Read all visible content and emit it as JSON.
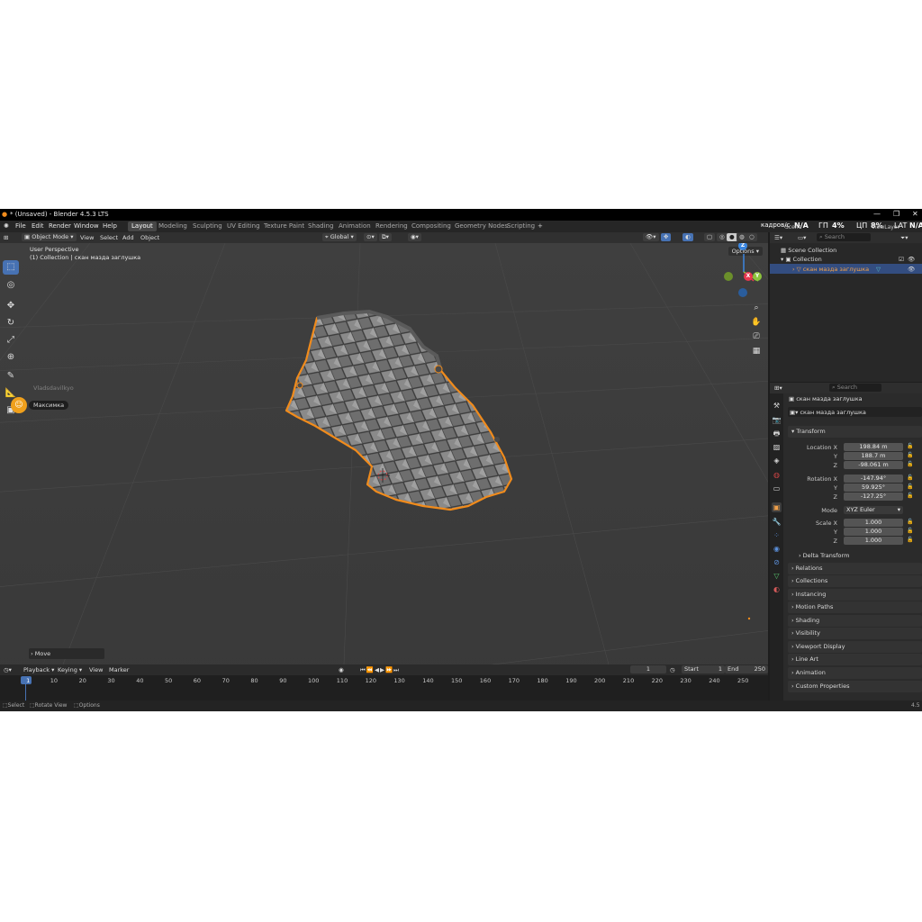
{
  "window": {
    "title": "* (Unsaved) - Blender 4.5.3 LTS",
    "controls": [
      "—",
      "❐",
      "✕"
    ]
  },
  "menus": [
    "File",
    "Edit",
    "Render",
    "Window",
    "Help"
  ],
  "workspaces": [
    "Layout",
    "Modeling",
    "Sculpting",
    "UV Editing",
    "Texture Paint",
    "Shading",
    "Animation",
    "Rendering",
    "Compositing",
    "Geometry Nodes",
    "Scripting"
  ],
  "active_workspace": "Layout",
  "overlay": {
    "fps_label": "кадров/с",
    "fps_value": "N/A",
    "gpu_label": "ГП",
    "gpu_value": "4%",
    "cpu_label": "ЦП",
    "cpu_value": "8%",
    "lat_label": "LAT",
    "lat_value": "N/A",
    "scene": "Scene",
    "view_layer": "ViewLayer"
  },
  "viewport_header": {
    "mode": "Object Mode",
    "menus": [
      "View",
      "Select",
      "Add",
      "Object"
    ],
    "transform_orientation": "Global",
    "options": "Options"
  },
  "viewport": {
    "perspective": "User Perspective",
    "collection_info": "(1) Collection | скан мазда заглушка",
    "move_panel": "Move",
    "gizmo": {
      "x": "X",
      "y": "Y",
      "z": "Z"
    }
  },
  "discord": {
    "user1": "Vladsdavilkyo",
    "user2": "Максимка"
  },
  "timeline": {
    "menus": [
      "Playback",
      "Keying",
      "View",
      "Marker"
    ],
    "current_frame": "1",
    "start_label": "Start",
    "start": "1",
    "end_label": "End",
    "end": "250",
    "ticks": [
      "1",
      "10",
      "20",
      "30",
      "40",
      "50",
      "60",
      "70",
      "80",
      "90",
      "100",
      "110",
      "120",
      "130",
      "140",
      "150",
      "160",
      "170",
      "180",
      "190",
      "200",
      "210",
      "220",
      "230",
      "240",
      "250"
    ]
  },
  "statusbar": {
    "select": "Select",
    "rotate": "Rotate View",
    "options": "Options",
    "version": "4.5"
  },
  "outliner": {
    "search_placeholder": "Search",
    "scene_collection": "Scene Collection",
    "collection": "Collection",
    "object": "скан мазда заглушка"
  },
  "properties": {
    "search_placeholder": "Search",
    "object_name": "скан мазда заглушка",
    "datablock_name": "скан мазда заглушка",
    "transform_title": "Transform",
    "location_label": "Location X",
    "location": [
      "198.84 m",
      "188.7 m",
      "-98.061 m"
    ],
    "rotation_label": "Rotation X",
    "rotation": [
      "-147.94°",
      "59.925°",
      "-127.25°"
    ],
    "mode_label": "Mode",
    "mode_value": "XYZ Euler",
    "scale_label": "Scale X",
    "scale": [
      "1.000",
      "1.000",
      "1.000"
    ],
    "axis_y": "Y",
    "axis_z": "Z",
    "delta_transform": "Delta Transform",
    "sections": [
      "Relations",
      "Collections",
      "Instancing",
      "Motion Paths",
      "Shading",
      "Visibility",
      "Viewport Display",
      "Line Art",
      "Animation",
      "Custom Properties"
    ]
  },
  "colors": {
    "accent": "#4772b3",
    "selection": "#f08b1c",
    "axis_x": "#e8384f",
    "axis_y": "#8bc23c",
    "axis_z": "#3b86e0"
  }
}
